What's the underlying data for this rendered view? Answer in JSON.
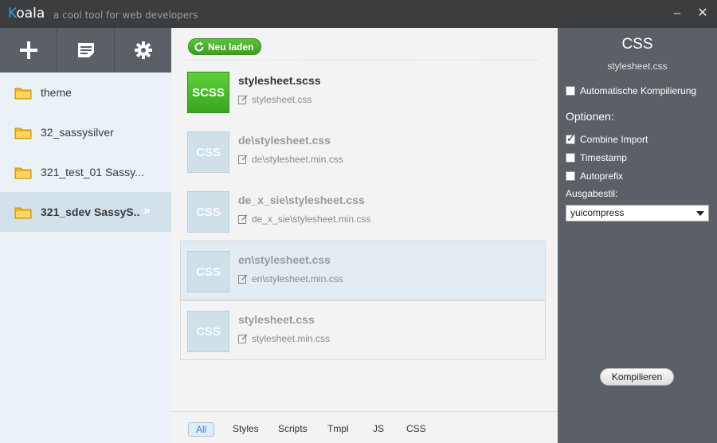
{
  "titlebar": {
    "logo_k": "K",
    "logo_rest": "oala",
    "slogan": "a cool tool for web developers",
    "minimize": "–",
    "close": "✕"
  },
  "sidebar": {
    "tools": [
      "plus-icon",
      "list-icon",
      "gear-icon"
    ],
    "projects": [
      {
        "label": "theme",
        "active": false
      },
      {
        "label": "32_sassysilver",
        "active": false
      },
      {
        "label": "321_test_01 Sassy...",
        "active": false
      },
      {
        "label": "321_sdev SassyS..",
        "active": true
      }
    ],
    "active_arrows": "»"
  },
  "main": {
    "reload_label": "Neu laden",
    "files": [
      {
        "type": "SCSS",
        "name": "stylesheet.scss",
        "output": "stylesheet.css"
      },
      {
        "type": "CSS",
        "name": "de\\stylesheet.css",
        "output": "de\\stylesheet.min.css"
      },
      {
        "type": "CSS",
        "name": "de_x_sie\\stylesheet.css",
        "output": "de_x_sie\\stylesheet.min.css"
      },
      {
        "type": "CSS",
        "name": "en\\stylesheet.css",
        "output": "en\\stylesheet.min.css"
      },
      {
        "type": "CSS",
        "name": "stylesheet.css",
        "output": "stylesheet.min.css"
      }
    ],
    "filters": [
      "All",
      "Styles",
      "Scripts",
      "Tmpl",
      "JS",
      "CSS"
    ]
  },
  "panel": {
    "title": "CSS",
    "subtitle": "stylesheet.css",
    "auto_compile": {
      "label": "Automatische Kompilierung",
      "checked": false
    },
    "options_label": "Optionen:",
    "combine_import": {
      "label": "Combine Import",
      "checked": true
    },
    "timestamp": {
      "label": "Timestamp",
      "checked": false
    },
    "autoprefix": {
      "label": "Autoprefix",
      "checked": false
    },
    "output_style_label": "Ausgabestil:",
    "output_style_value": "yuicompress",
    "compile_label": "Kompilieren"
  },
  "colors": {
    "accent_blue": "#27a3e0",
    "scss_green": "#4cbb2d",
    "panel_gray": "#5b6066",
    "title_bar": "#3c3d3e"
  }
}
